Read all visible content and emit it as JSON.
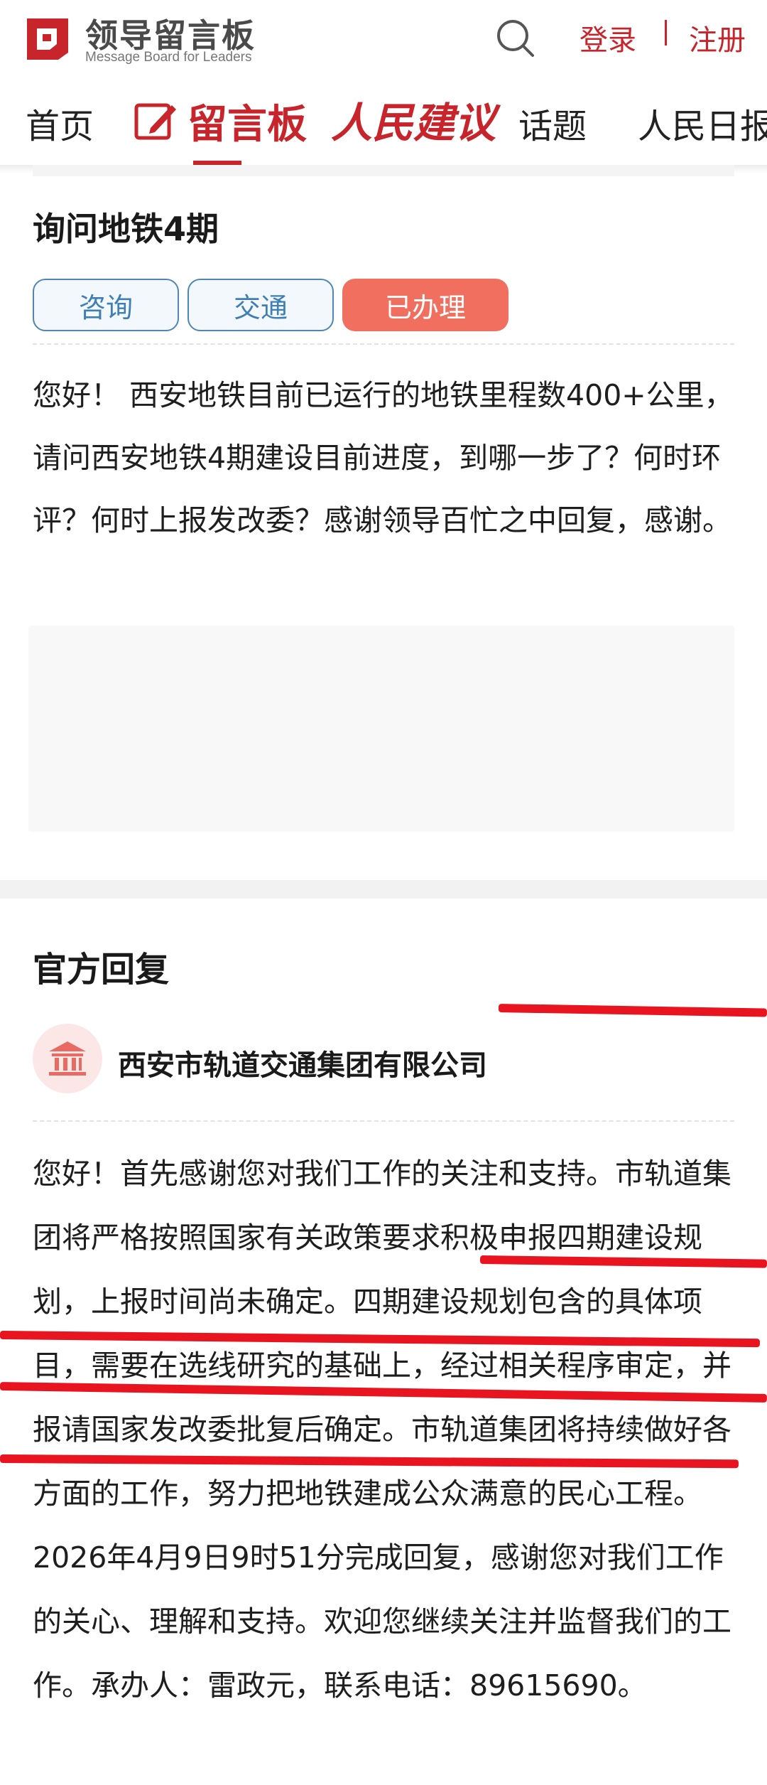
{
  "header": {
    "logo_title": "领导留言板",
    "logo_subtitle": "Message Board for Leaders",
    "login_label": "登录",
    "register_label": "注册",
    "accent_color": "#c8242b"
  },
  "nav": {
    "items": [
      {
        "label": "首页"
      },
      {
        "label": "留言板",
        "active": true
      },
      {
        "label": "人民建议"
      },
      {
        "label": "话题"
      },
      {
        "label": "人民日报"
      }
    ]
  },
  "question": {
    "title": "询问地铁4期",
    "tags": [
      "咨询",
      "交通",
      "已办理"
    ],
    "body": "您好！ 西安地铁目前已运行的地铁里程数400+公里，请问西安地铁4期建设目前进度，到哪一步了？何时环评？何时上报发改委？感谢领导百忙之中回复，感谢。"
  },
  "reply": {
    "heading": "官方回复",
    "org_name": "西安市轨道交通集团有限公司",
    "org_icon": "government-building-icon",
    "body": "您好！首先感谢您对我们工作的关注和支持。市轨道集团将严格按照国家有关政策要求积极申报四期建设规划，上报时间尚未确定。四期建设规划包含的具体项目，需要在选线研究的基础上，经过相关程序审定，并报请国家发改委批复后确定。市轨道集团将持续做好各方面的工作，努力把地铁建成公众满意的民心工程。2026年4月9日9时51分完成回复，感谢您对我们工作的关心、理解和支持。欢迎您继续关注并监督我们的工作。承办人：雷政元，联系电话：89615690。"
  },
  "annotation_color": "#e8141f"
}
